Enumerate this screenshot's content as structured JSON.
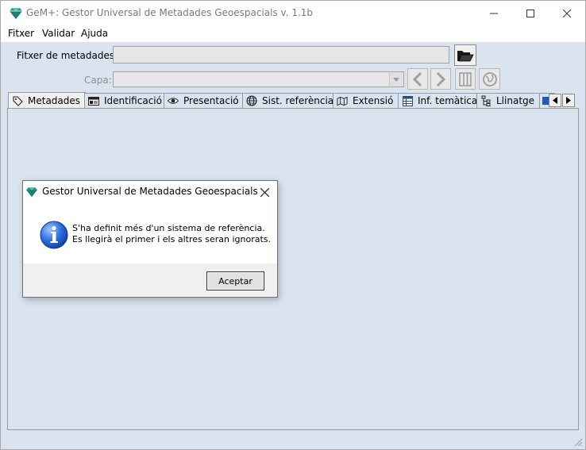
{
  "window": {
    "title": "GeM+: Gestor Universal de Metadades Geoespacials v. 1.1b",
    "icon": "gem-icon"
  },
  "menu": {
    "items": [
      "Fitxer",
      "Validar",
      "Ajuda"
    ]
  },
  "form": {
    "file_label": "Fitxer de metadades:",
    "file_value": "",
    "layer_label": "Capa:",
    "layer_value": ""
  },
  "tabs": [
    {
      "label": "Metadades",
      "icon": "tag-icon",
      "active": true
    },
    {
      "label": "Identificació",
      "icon": "id-card-icon"
    },
    {
      "label": "Presentació",
      "icon": "eye-icon"
    },
    {
      "label": "Sist. referència",
      "icon": "globe-icon"
    },
    {
      "label": "Extensió",
      "icon": "map-icon"
    },
    {
      "label": "Inf. temàtica",
      "icon": "table-icon"
    },
    {
      "label": "Llinatge",
      "icon": "tree-icon"
    }
  ],
  "dialog": {
    "title": "Gestor Universal de Metadades Geoespacials",
    "icon": "info-icon",
    "message_line1": "S'ha definit més d'un sistema de referència.",
    "message_line2": "Es llegirà el primer i els altres seran ignorats.",
    "ok_label": "Aceptar"
  },
  "colors": {
    "background": "#dae3f0",
    "accent": "#2c9b8f"
  }
}
